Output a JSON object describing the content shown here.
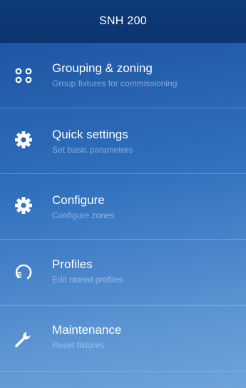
{
  "header": {
    "title": "SNH 200"
  },
  "menu": {
    "items": [
      {
        "title": "Grouping & zoning",
        "subtitle": "Group fixtures for commissioning",
        "icon": "grouping-dots-icon"
      },
      {
        "title": "Quick settings",
        "subtitle": "Set basic parameters",
        "icon": "gear-icon"
      },
      {
        "title": "Configure",
        "subtitle": "Configure zones",
        "icon": "gear-icon"
      },
      {
        "title": "Profiles",
        "subtitle": "Edit stored profiles",
        "icon": "profiles-icon"
      },
      {
        "title": "Maintenance",
        "subtitle": "Reset fixtures",
        "icon": "wrench-icon"
      }
    ]
  },
  "colors": {
    "header_bg": "#0e3a78",
    "body_gradient_top": "#1a4f9c",
    "body_gradient_bottom": "#6fa2db",
    "subtitle_text": "#d2e4fa"
  }
}
